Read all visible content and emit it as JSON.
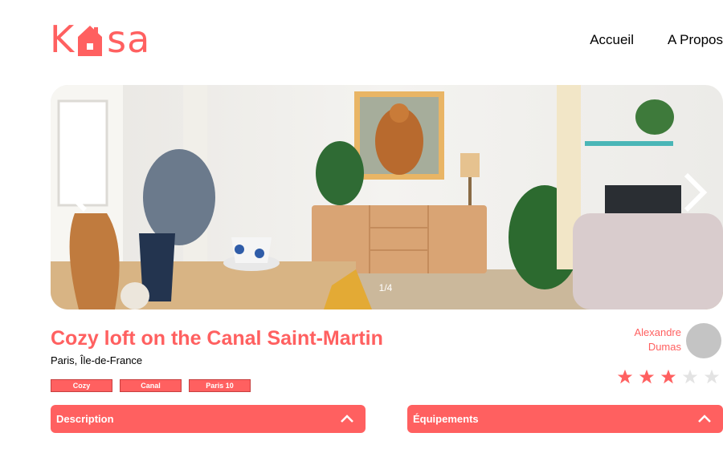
{
  "brand": {
    "name_before": "K",
    "name_after": "sa",
    "color": "#FF6060"
  },
  "nav": {
    "home": "Accueil",
    "about": "A Propos"
  },
  "carousel": {
    "counter": "1/4",
    "prev_icon": "chevron-left-icon",
    "next_icon": "chevron-right-icon"
  },
  "listing": {
    "title": "Cozy loft on the Canal Saint-Martin",
    "location": "Paris, Île-de-France",
    "tags": [
      "Cozy",
      "Canal",
      "Paris 10"
    ]
  },
  "host": {
    "first_name": "Alexandre",
    "last_name": "Dumas"
  },
  "rating": {
    "value": 3,
    "max": 5,
    "filled_color": "#FF6060",
    "empty_color": "#E3E3E3"
  },
  "sections": {
    "description": "Description",
    "equipment": "Équipements"
  }
}
